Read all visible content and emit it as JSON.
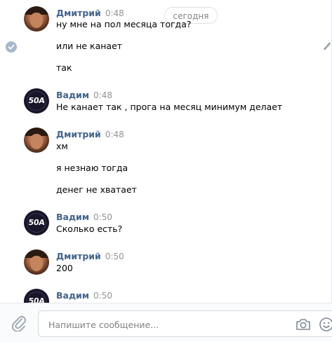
{
  "date_pill": "сегодня",
  "messages": [
    {
      "author": "Дмитрий",
      "time": "0:48",
      "lines": [
        "ну мне на пол месяца тогда?",
        "или не канает",
        "так"
      ]
    },
    {
      "author": "Вадим",
      "time": "0:48",
      "lines": [
        "Не канает так , прога на месяц минимум делает"
      ]
    },
    {
      "author": "Дмитрий",
      "time": "0:48",
      "lines": [
        "хм",
        "я незнаю тогда",
        "денег не хватает"
      ]
    },
    {
      "author": "Вадим",
      "time": "0:50",
      "lines": [
        "Сколько есть?"
      ]
    },
    {
      "author": "Дмитрий",
      "time": "0:50",
      "lines": [
        "200"
      ]
    },
    {
      "author": "Вадим",
      "time": "0:50",
      "lines": []
    }
  ],
  "vadim_avatar_text": "50A",
  "composer": {
    "placeholder": "Напишите сообщение..."
  },
  "icons": {
    "read_check": "check-circle-icon",
    "edit": "pencil-icon",
    "attach": "paperclip-icon",
    "camera": "camera-icon",
    "emoji": "smile-icon"
  },
  "colors": {
    "author": "#42648b",
    "time": "#939393",
    "check": "#a5b7cb"
  }
}
